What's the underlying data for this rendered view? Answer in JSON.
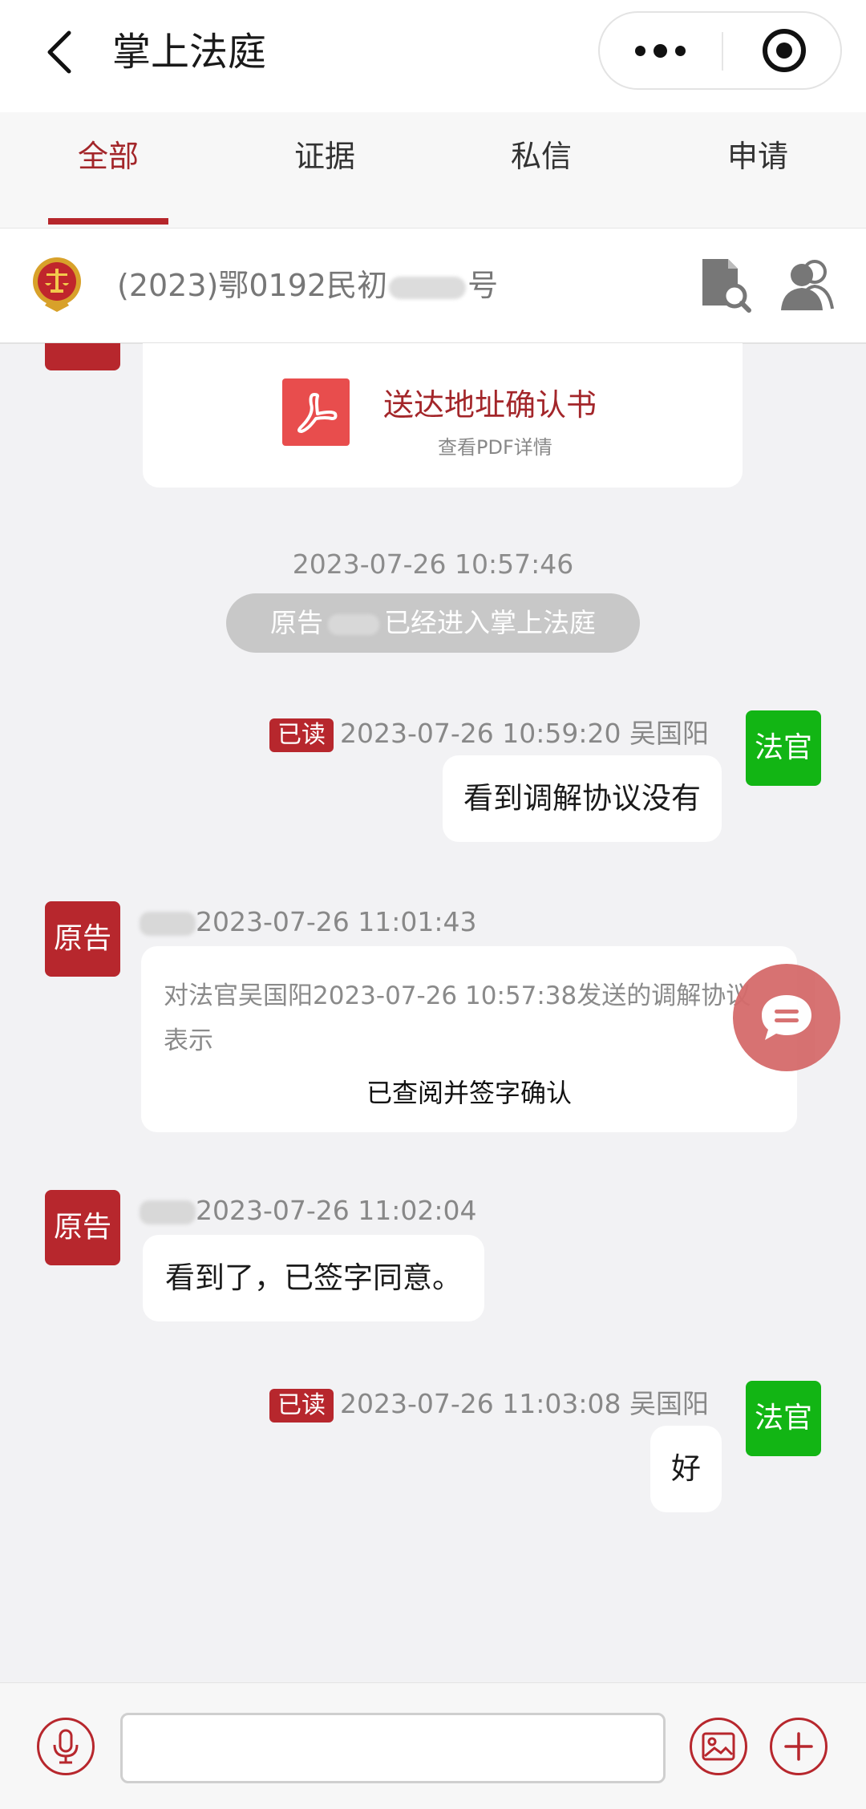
{
  "header": {
    "title": "掌上法庭",
    "back_icon": "chevron-left-icon",
    "more_icon": "more-dots-icon",
    "target_icon": "record-target-icon"
  },
  "tabs": [
    {
      "label": "全部",
      "active": true
    },
    {
      "label": "证据",
      "active": false
    },
    {
      "label": "私信",
      "active": false
    },
    {
      "label": "申请",
      "active": false
    }
  ],
  "case": {
    "number_prefix": "(2023)鄂0192民初",
    "number_suffix": "号"
  },
  "pdf": {
    "title": "送达地址确认书",
    "subtitle": "查看PDF详情"
  },
  "system_msg": {
    "time": "2023-07-26 10:57:46",
    "text_prefix": "原告",
    "text_suffix": "已经进入掌上法庭"
  },
  "messages": [
    {
      "side": "right",
      "read_label": "已读",
      "time": "2023-07-26 10:59:20",
      "sender": "吴国阳",
      "role": "法官",
      "text": "看到调解协议没有"
    },
    {
      "side": "left",
      "time": "2023-07-26 11:01:43",
      "role": "原告",
      "line1": "对法官吴国阳2023-07-26 10:57:38发送的调解协议",
      "line2": "表示",
      "confirm": "已查阅并签字确认"
    },
    {
      "side": "left",
      "time": "2023-07-26 11:02:04",
      "role": "原告",
      "text": "看到了，已签字同意。"
    },
    {
      "side": "right",
      "read_label": "已读",
      "time": "2023-07-26 11:03:08",
      "sender": "吴国阳",
      "role": "法官",
      "text": "好"
    }
  ],
  "footer": {
    "input_placeholder": ""
  },
  "colors": {
    "brand_red": "#b7272d",
    "judge_green": "#12b514",
    "tab_active": "#a3262a"
  }
}
